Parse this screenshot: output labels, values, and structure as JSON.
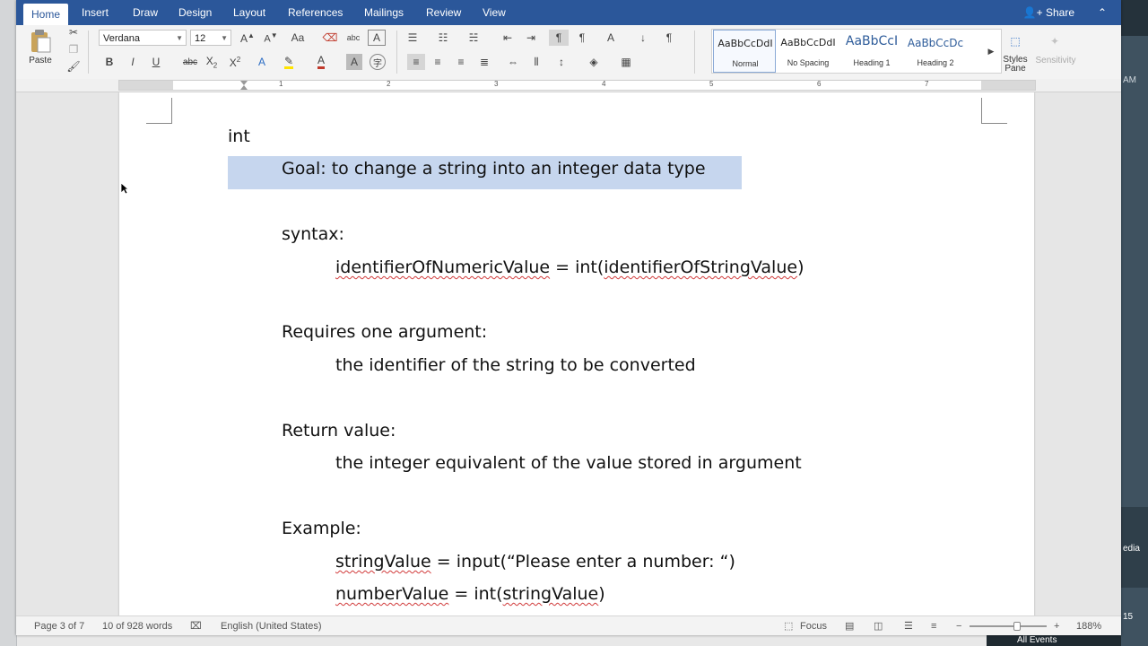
{
  "tabs": [
    "Home",
    "Insert",
    "Draw",
    "Design",
    "Layout",
    "References",
    "Mailings",
    "Review",
    "View"
  ],
  "active_tab": "Home",
  "share_label": "Share",
  "ribbon": {
    "paste_label": "Paste",
    "font_name": "Verdana",
    "font_size": "12",
    "styles": [
      {
        "preview": "AaBbCcDdI",
        "name": "Normal",
        "selected": true
      },
      {
        "preview": "AaBbCcDdI",
        "name": "No Spacing",
        "selected": false
      },
      {
        "preview": "AaBbCcI",
        "name": "Heading 1",
        "selected": false
      },
      {
        "preview": "AaBbCcDc",
        "name": "Heading 2",
        "selected": false
      }
    ],
    "styles_pane_label": "Styles\nPane",
    "sensitivity_label": "Sensitivity"
  },
  "ruler_numbers": [
    "1",
    "2",
    "3",
    "4",
    "5",
    "6",
    "7"
  ],
  "document": {
    "heading": "int",
    "goal": "Goal: to change a string into an integer data type",
    "syntax_label": "syntax:",
    "syntax_lhs": "identifierOfNumericValue",
    "syntax_mid": " = int(",
    "syntax_arg": "identifierOfStringValue",
    "syntax_end": ")",
    "requires_label": "Requires one argument:",
    "requires_text": "the identifier of the string to be converted",
    "return_label": "Return value:",
    "return_text": "the integer equivalent of the value stored in argument",
    "example_label": "Example:",
    "example_line1_var": "stringValue",
    "example_line1_rest": " = input(“Please enter a number: “)",
    "example_line2_var": "numberValue",
    "example_line2_mid": " = int(",
    "example_line2_arg": "stringValue",
    "example_line2_end": ")"
  },
  "status": {
    "page": "Page 3 of 7",
    "words": "10 of 928 words",
    "language": "English (United States)",
    "focus": "Focus",
    "zoom": "188%"
  },
  "desktop": {
    "right_text_1": "edia",
    "right_text_2": "All Events",
    "right_text_3": "AM",
    "right_text_4": "15"
  }
}
